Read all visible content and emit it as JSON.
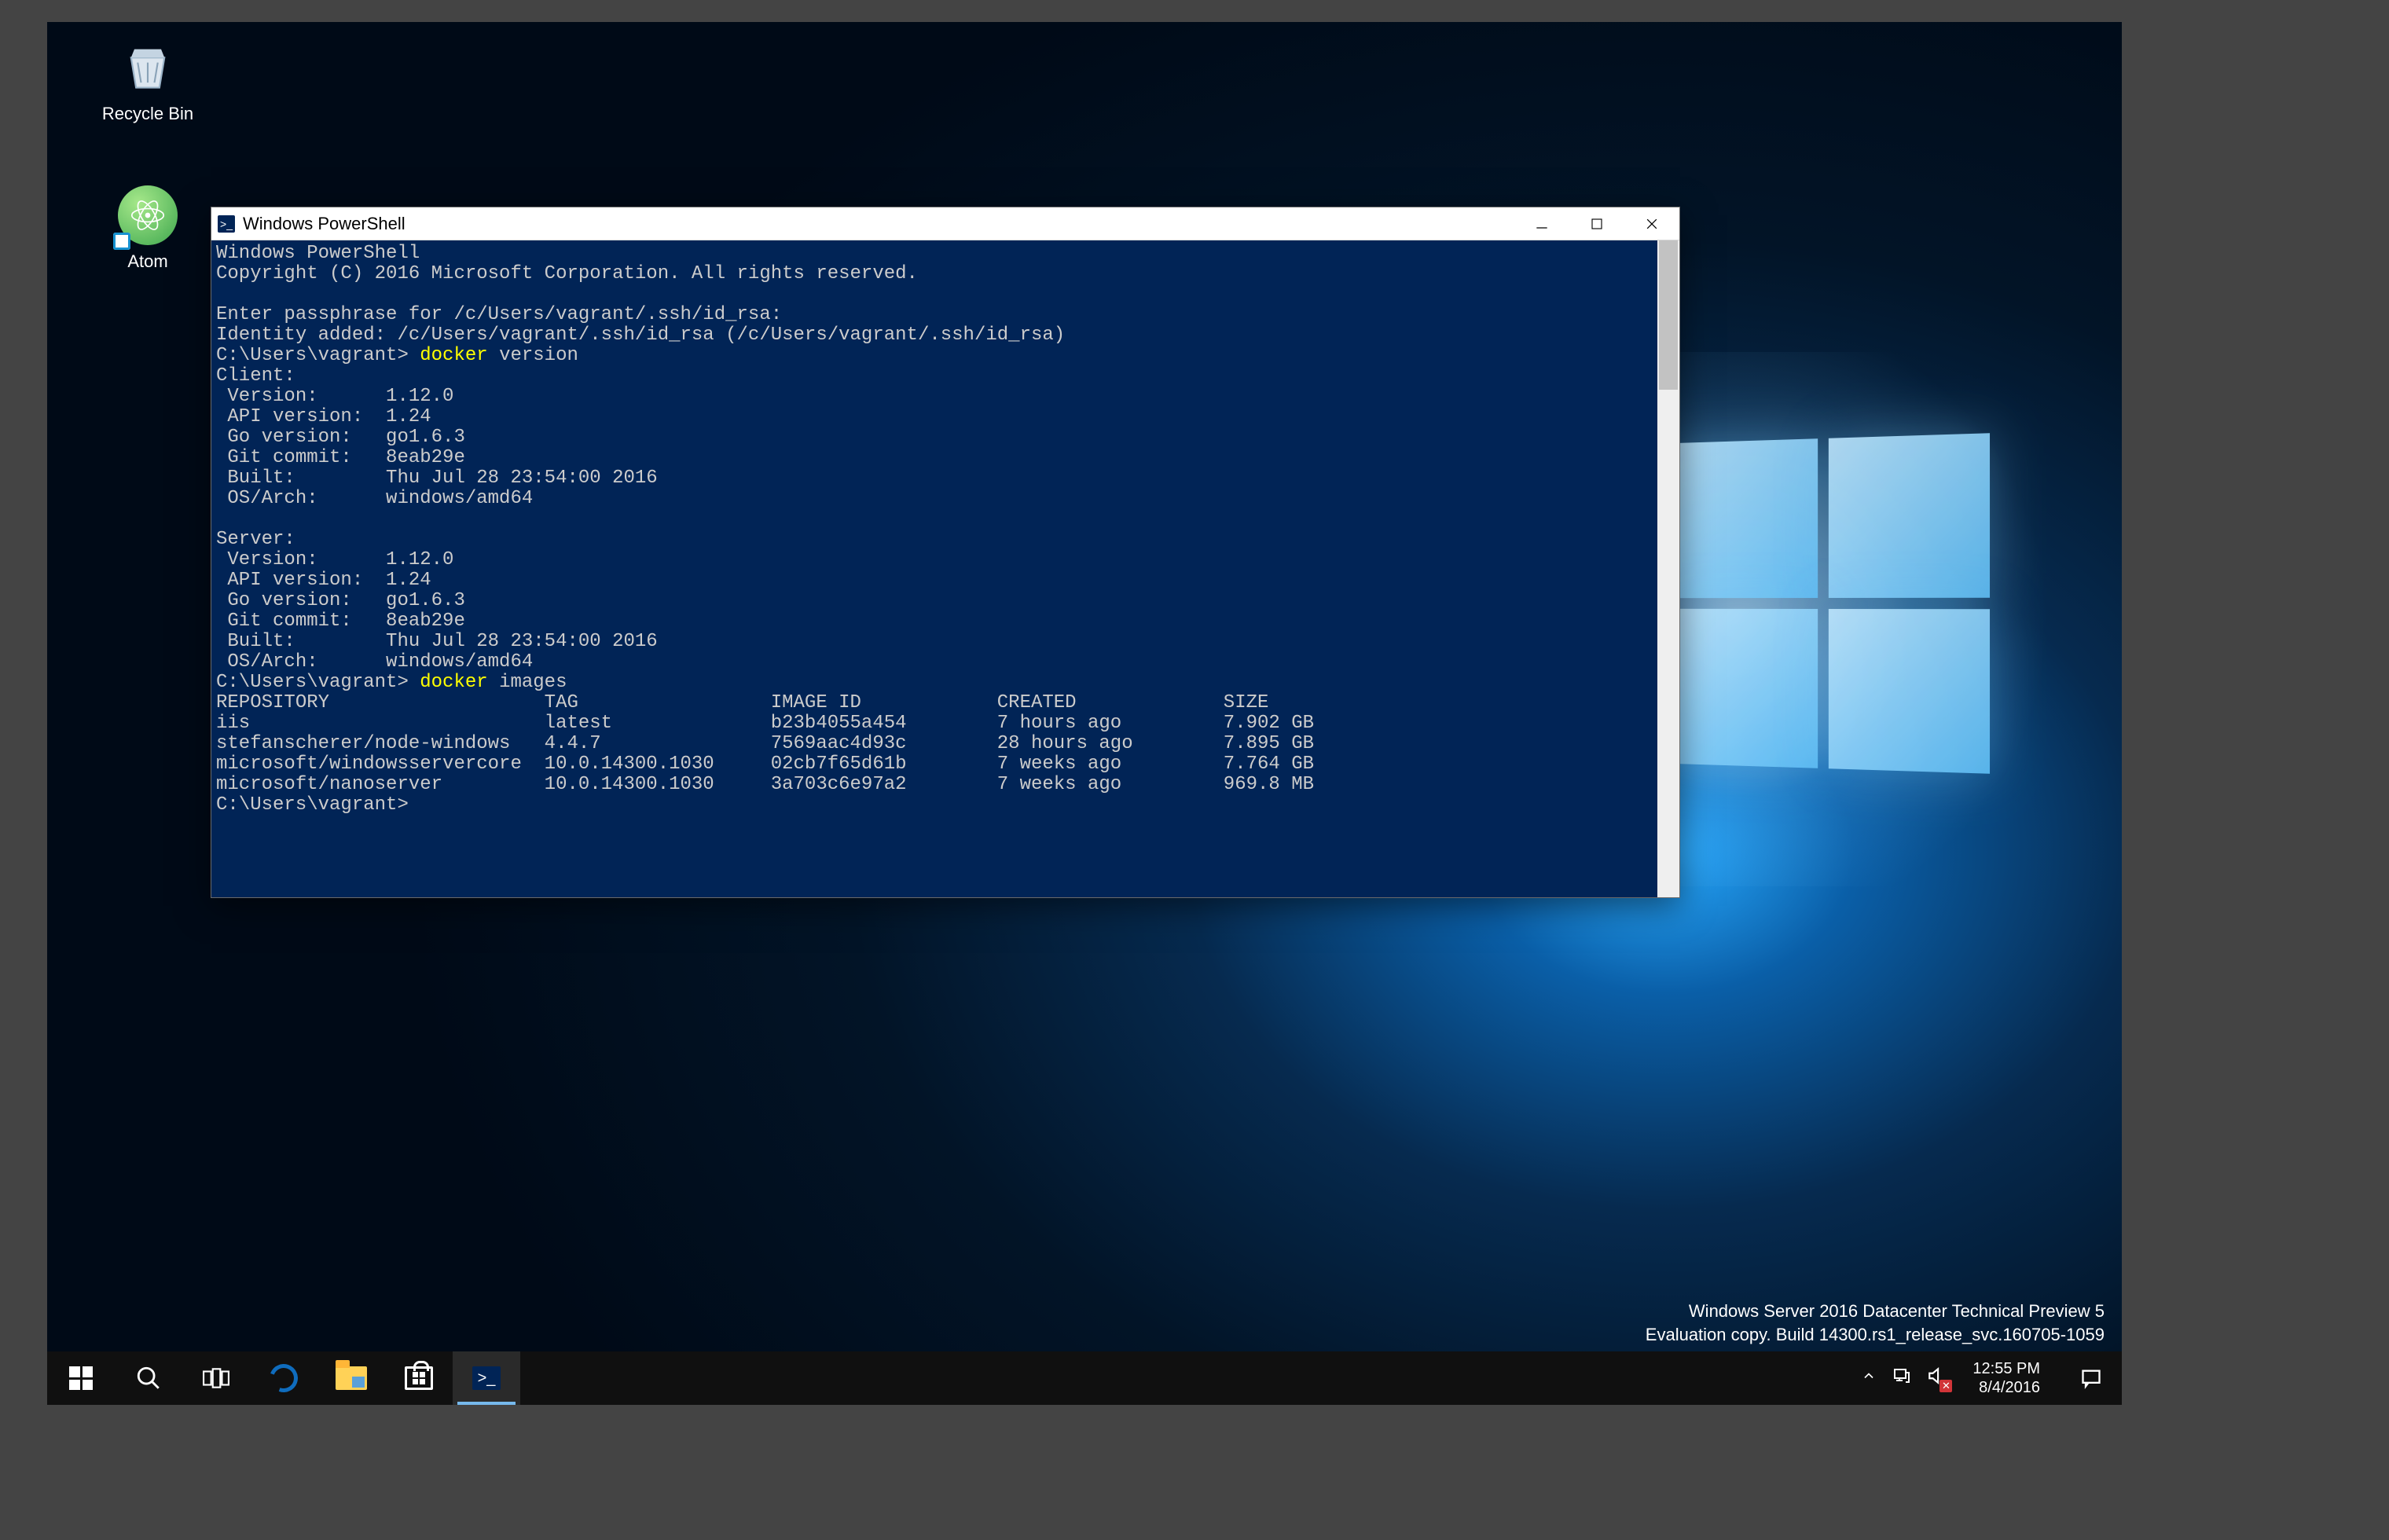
{
  "desktop_icons": {
    "recycle": "Recycle Bin",
    "atom": "Atom"
  },
  "window": {
    "title": "Windows PowerShell"
  },
  "terminal": {
    "header1": "Windows PowerShell",
    "header2": "Copyright (C) 2016 Microsoft Corporation. All rights reserved.",
    "passphrase": "Enter passphrase for /c/Users/vagrant/.ssh/id_rsa:",
    "identity": "Identity added: /c/Users/vagrant/.ssh/id_rsa (/c/Users/vagrant/.ssh/id_rsa)",
    "prompt1_pre": "C:\\Users\\vagrant> ",
    "cmd1": "docker",
    "cmd1_args": " version",
    "client_label": "Client:",
    "server_label": "Server:",
    "kv_client": [
      " Version:      1.12.0",
      " API version:  1.24",
      " Go version:   go1.6.3",
      " Git commit:   8eab29e",
      " Built:        Thu Jul 28 23:54:00 2016",
      " OS/Arch:      windows/amd64"
    ],
    "kv_server": [
      " Version:      1.12.0",
      " API version:  1.24",
      " Go version:   go1.6.3",
      " Git commit:   8eab29e",
      " Built:        Thu Jul 28 23:54:00 2016",
      " OS/Arch:      windows/amd64"
    ],
    "prompt2_pre": "C:\\Users\\vagrant> ",
    "cmd2": "docker",
    "cmd2_args": " images",
    "images_header": "REPOSITORY                   TAG                 IMAGE ID            CREATED             SIZE",
    "images_rows": [
      "iis                          latest              b23b4055a454        7 hours ago         7.902 GB",
      "stefanscherer/node-windows   4.4.7               7569aac4d93c        28 hours ago        7.895 GB",
      "microsoft/windowsservercore  10.0.14300.1030     02cb7f65d61b        7 weeks ago         7.764 GB",
      "microsoft/nanoserver         10.0.14300.1030     3a703c6e97a2        7 weeks ago         969.8 MB"
    ],
    "prompt3": "C:\\Users\\vagrant>"
  },
  "watermark": {
    "line1": "Windows Server 2016 Datacenter Technical Preview 5",
    "line2": "Evaluation copy. Build 14300.rs1_release_svc.160705-1059"
  },
  "clock": {
    "time": "12:55 PM",
    "date": "8/4/2016"
  }
}
